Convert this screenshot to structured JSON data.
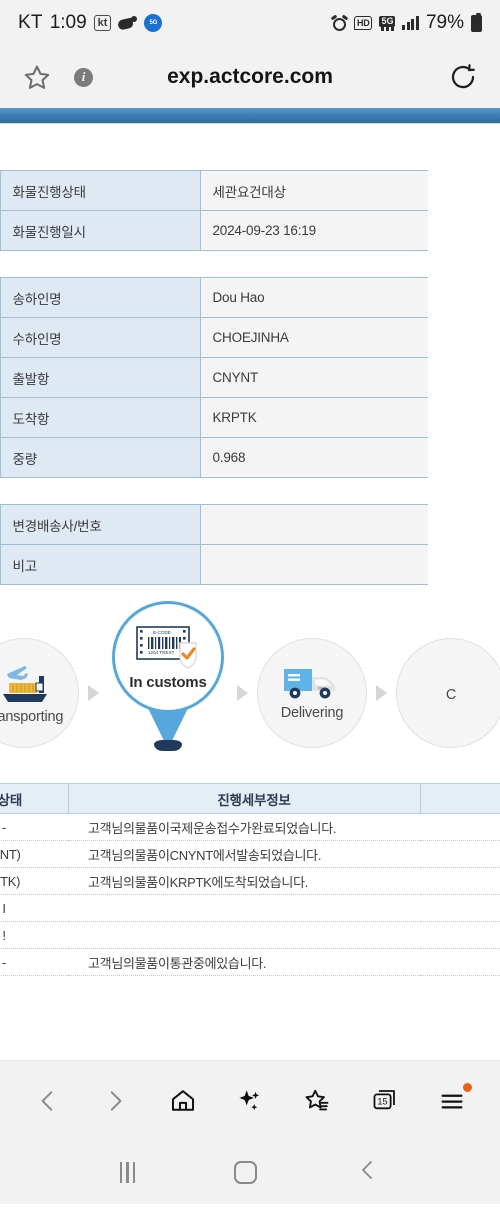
{
  "status_bar": {
    "carrier": "KT",
    "time": "1:09",
    "kt_badge": "kt",
    "blue_badge": "5G",
    "hd_badge": "HD",
    "fiveg_badge": "5G",
    "battery_percent": "79%",
    "icons": [
      "kt-badge-icon",
      "call-forward-icon",
      "blue-app-icon",
      "alarm-icon",
      "hd-icon",
      "5g-icon",
      "signal-bars-icon",
      "battery-icon"
    ]
  },
  "browser": {
    "url": "exp.actcore.com",
    "bookmark_icon": "star-outline-icon",
    "info_icon": "info-circle-icon",
    "reload_icon": "reload-icon"
  },
  "info_table_1": {
    "rows": [
      {
        "blank": "",
        "label": "화물진행상태",
        "value": "세관요건대상"
      },
      {
        "blank": "",
        "label": "화물진행일시",
        "value": "2024-09-23 16:19"
      }
    ]
  },
  "info_table_2": {
    "rows": [
      {
        "blank": "",
        "label": "송하인명",
        "value": "Dou Hao"
      },
      {
        "blank": "",
        "label": "수하인명",
        "value": "CHOEJINHA"
      },
      {
        "blank": "",
        "label": "출발항",
        "value": "CNYNT"
      },
      {
        "blank": "",
        "label": "도착항",
        "value": "KRPTK"
      },
      {
        "blank": "",
        "label": "중량",
        "value": "0.968"
      }
    ]
  },
  "info_table_3": {
    "rows": [
      {
        "blank": "",
        "label": "변경배송사/번호",
        "value": ""
      },
      {
        "blank": "",
        "label": "비고",
        "value": ""
      }
    ]
  },
  "tracker": {
    "steps": [
      {
        "label": "Transporting",
        "icon": "ship-plane-icon",
        "state": "done"
      },
      {
        "label": "In customs",
        "icon": "barcode-shield-icon",
        "state": "current"
      },
      {
        "label": "Delivering",
        "icon": "truck-icon",
        "state": "pending"
      },
      {
        "label": "C",
        "icon": "completed-icon",
        "state": "pending"
      }
    ],
    "arrow_icon": "triangle-right-icon"
  },
  "history_table": {
    "headers": [
      "행상태",
      "진행세부정보",
      ""
    ],
    "rows": [
      {
        "state": "-",
        "detail": "고객님의물품이국제운송접수가완료되었습니다.",
        "extra": ""
      },
      {
        "state": "(YNT)",
        "detail": "고객님의물품이CNYNT에서발송되었습니다.",
        "extra": ""
      },
      {
        "state": "(PTK)",
        "detail": "고객님의물품이KRPTK에도착되었습니다.",
        "extra": ""
      },
      {
        "state": "I",
        "detail": "",
        "extra": ""
      },
      {
        "state": "!",
        "detail": "",
        "extra": ""
      },
      {
        "state": "-",
        "detail": "고객님의물품이통관중에있습니다.",
        "extra": ""
      }
    ]
  },
  "bottom_nav": {
    "items": [
      {
        "name": "back-icon",
        "label": "Back"
      },
      {
        "name": "forward-icon",
        "label": "Forward"
      },
      {
        "name": "home-icon",
        "label": "Home"
      },
      {
        "name": "sparkle-icon",
        "label": "Assistant"
      },
      {
        "name": "bookmarks-icon",
        "label": "Bookmarks"
      },
      {
        "name": "tabs-icon",
        "label": "Tabs"
      },
      {
        "name": "menu-icon",
        "label": "Menu"
      }
    ],
    "tab_count": "15",
    "menu_has_notification": true
  },
  "system_nav": {
    "recents_icon": "recents-icon",
    "home_icon": "home-square-icon",
    "back_icon": "chevron-left-icon"
  },
  "colors": {
    "brand_blue": "#3f7fb4",
    "pin_blue": "#55a7dd",
    "label_cell_bg": "#dfe9f4",
    "value_cell_bg": "#f4f4f4",
    "header_bg": "#e5edf6",
    "notification_dot": "#e8621f"
  }
}
